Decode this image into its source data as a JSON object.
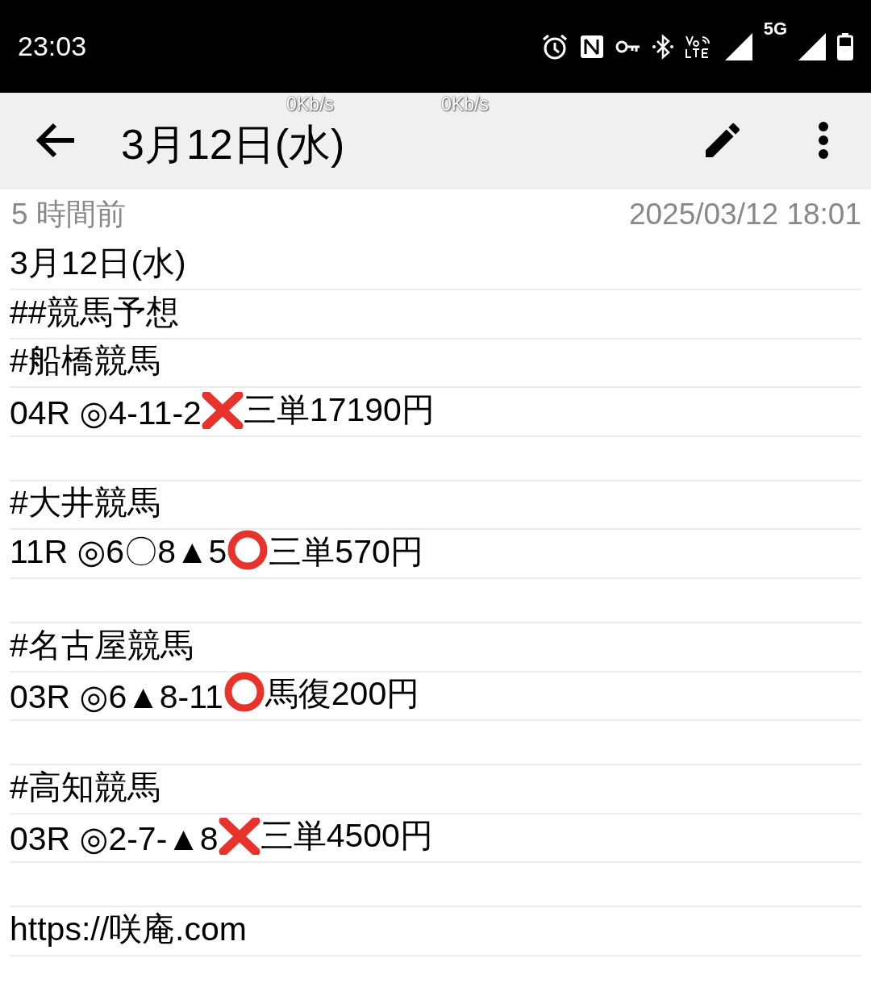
{
  "status_bar": {
    "time": "23:03",
    "network_label": "5G"
  },
  "speed_overlays": [
    "0Kb/s",
    "0Kb/s"
  ],
  "app_bar": {
    "title": "3月12日(水)"
  },
  "meta": {
    "relative_time": "5 時間前",
    "timestamp": "2025/03/12 18:01"
  },
  "note_lines": [
    {
      "segments": [
        {
          "kind": "text",
          "text": "3月12日(水)"
        }
      ]
    },
    {
      "segments": [
        {
          "kind": "text",
          "text": "##競馬予想"
        }
      ]
    },
    {
      "segments": [
        {
          "kind": "text",
          "text": "#船橋競馬"
        }
      ]
    },
    {
      "segments": [
        {
          "kind": "text",
          "text": "04R ◎4-11-2"
        },
        {
          "kind": "cross"
        },
        {
          "kind": "text",
          "text": "三単17190円"
        }
      ]
    },
    {
      "kind": "blank"
    },
    {
      "segments": [
        {
          "kind": "text",
          "text": "#大井競馬"
        }
      ]
    },
    {
      "segments": [
        {
          "kind": "text",
          "text": "11R ◎6〇8▲5"
        },
        {
          "kind": "circle"
        },
        {
          "kind": "text",
          "text": "三単570円"
        }
      ]
    },
    {
      "kind": "blank"
    },
    {
      "segments": [
        {
          "kind": "text",
          "text": "#名古屋競馬"
        }
      ]
    },
    {
      "segments": [
        {
          "kind": "text",
          "text": "03R ◎6▲8-11"
        },
        {
          "kind": "circle"
        },
        {
          "kind": "text",
          "text": "馬復200円"
        }
      ]
    },
    {
      "kind": "blank"
    },
    {
      "segments": [
        {
          "kind": "text",
          "text": "#高知競馬"
        }
      ]
    },
    {
      "segments": [
        {
          "kind": "text",
          "text": "03R ◎2-7-▲8"
        },
        {
          "kind": "cross"
        },
        {
          "kind": "text",
          "text": "三単4500円"
        }
      ]
    },
    {
      "kind": "blank"
    },
    {
      "segments": [
        {
          "kind": "text",
          "text": "https://咲庵.com"
        }
      ]
    }
  ]
}
